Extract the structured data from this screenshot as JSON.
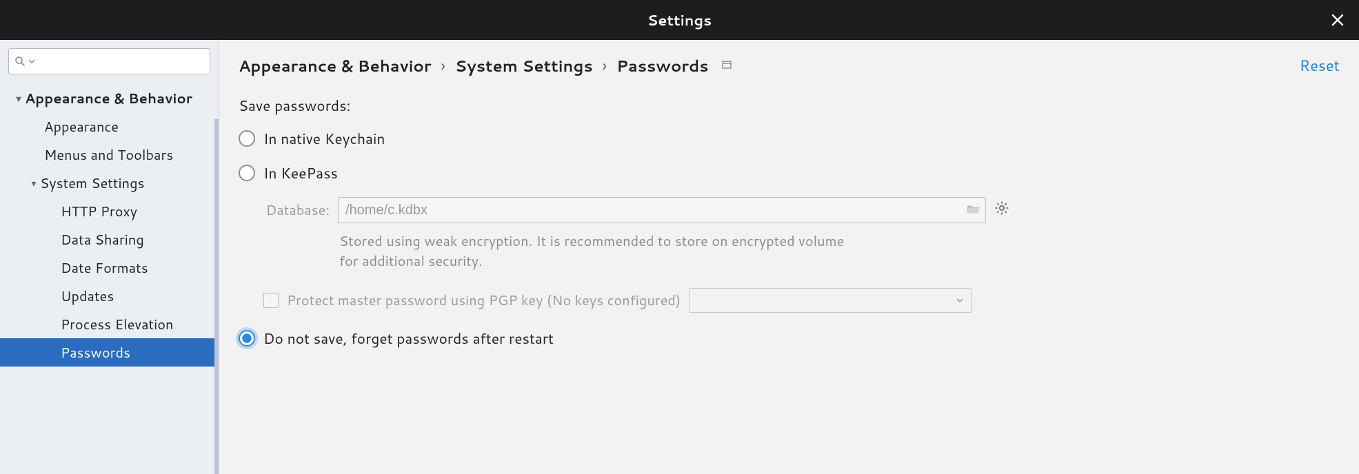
{
  "window": {
    "title": "Settings"
  },
  "search": {
    "placeholder": ""
  },
  "sidebar": {
    "items": [
      {
        "label": "Appearance & Behavior"
      },
      {
        "label": "Appearance"
      },
      {
        "label": "Menus and Toolbars"
      },
      {
        "label": "System Settings"
      },
      {
        "label": "HTTP Proxy"
      },
      {
        "label": "Data Sharing"
      },
      {
        "label": "Date Formats"
      },
      {
        "label": "Updates"
      },
      {
        "label": "Process Elevation"
      },
      {
        "label": "Passwords"
      }
    ]
  },
  "breadcrumb": {
    "a": "Appearance & Behavior",
    "b": "System Settings",
    "c": "Passwords"
  },
  "actions": {
    "reset": "Reset"
  },
  "form": {
    "section_label": "Save passwords:",
    "opt_native": "In native Keychain",
    "opt_keepass": "In KeePass",
    "db_label": "Database:",
    "db_value": "/home/c.kdbx",
    "hint": "Stored using weak encryption. It is recommended to store on encrypted volume for additional security.",
    "protect_label": "Protect master password using PGP key (No keys configured)",
    "opt_donotsave": "Do not save, forget passwords after restart"
  }
}
